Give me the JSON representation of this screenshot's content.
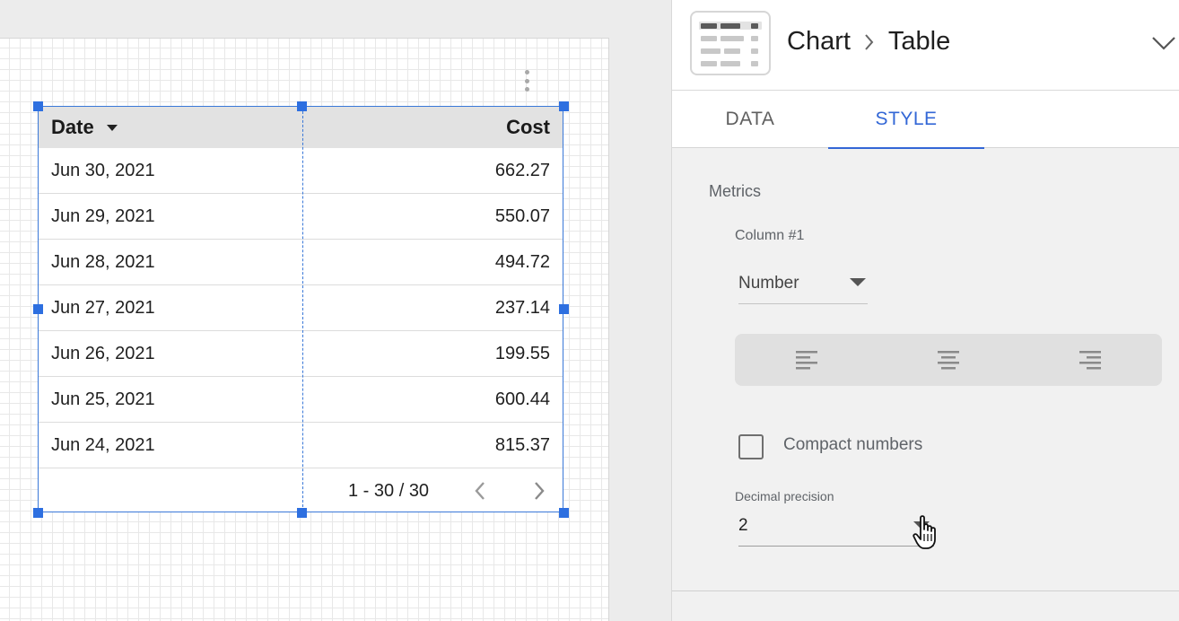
{
  "canvas": {
    "table": {
      "columns": {
        "date": "Date",
        "cost": "Cost"
      },
      "rows": [
        {
          "date": "Jun 30, 2021",
          "cost": "662.27"
        },
        {
          "date": "Jun 29, 2021",
          "cost": "550.07"
        },
        {
          "date": "Jun 28, 2021",
          "cost": "494.72"
        },
        {
          "date": "Jun 27, 2021",
          "cost": "237.14"
        },
        {
          "date": "Jun 26, 2021",
          "cost": "199.55"
        },
        {
          "date": "Jun 25, 2021",
          "cost": "600.44"
        },
        {
          "date": "Jun 24, 2021",
          "cost": "815.37"
        }
      ],
      "pagination": "1 - 30 / 30",
      "selection_color": "#3a78d8"
    }
  },
  "panel": {
    "breadcrumb": {
      "parent": "Chart",
      "current": "Table"
    },
    "tabs": {
      "data": "DATA",
      "style": "STYLE"
    },
    "active_tab": "STYLE",
    "accent_color": "#3367d6",
    "metrics": {
      "section_label": "Metrics",
      "column_label": "Column #1",
      "format_value": "Number",
      "compact_numbers_label": "Compact numbers",
      "compact_numbers_checked": false,
      "decimal_precision_label": "Decimal precision",
      "decimal_precision_value": "2"
    },
    "icons": [
      "table-chart-icon",
      "chevron-right-icon",
      "chevron-down-icon",
      "align-left-icon",
      "align-center-icon",
      "align-right-icon",
      "hand-pointer-icon"
    ]
  }
}
